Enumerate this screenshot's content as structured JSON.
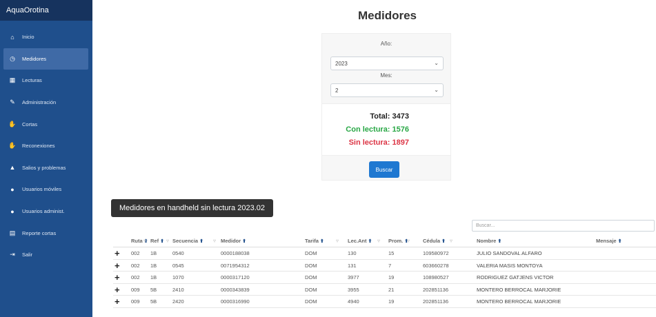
{
  "brand": "AquaOrotina",
  "sidebar": {
    "items": [
      {
        "label": "Inicio",
        "icon": "home-icon",
        "glyph": "⌂"
      },
      {
        "label": "Medidores",
        "icon": "clock-icon",
        "glyph": "◷",
        "active": true
      },
      {
        "label": "Lecturas",
        "icon": "calculator-icon",
        "glyph": "▦"
      },
      {
        "label": "Administración",
        "icon": "pencil-icon",
        "glyph": "✎"
      },
      {
        "label": "Cortas",
        "icon": "thumbs-down-icon",
        "glyph": "✋"
      },
      {
        "label": "Reconexiones",
        "icon": "thumbs-up-icon",
        "glyph": "✋"
      },
      {
        "label": "Salios y problemas",
        "icon": "warning-icon",
        "glyph": "▲"
      },
      {
        "label": "Usuarios móviles",
        "icon": "user-icon",
        "glyph": "●"
      },
      {
        "label": "Usuarios administ.",
        "icon": "users-icon",
        "glyph": "●"
      },
      {
        "label": "Reporte cortas",
        "icon": "report-icon",
        "glyph": "▤"
      },
      {
        "label": "Salir",
        "icon": "logout-icon",
        "glyph": "⇥"
      }
    ]
  },
  "main": {
    "title": "Medidores",
    "filter": {
      "year_label": "Año:",
      "year_value": "2023",
      "month_label": "Mes:",
      "month_value": "2",
      "total": "Total: 3473",
      "con_lectura": "Con lectura: 1576",
      "sin_lectura": "Sin lectura: 1897",
      "button": "Buscar"
    },
    "section_title": "Medidores en handheld sin lectura 2023.02",
    "search_placeholder": "Buscar...",
    "table": {
      "columns": [
        "Ruta",
        "Ref",
        "Secuencia",
        "Medidor",
        "Tarifa",
        "Lec.Ant",
        "Prom.",
        "Cédula",
        "Nombre",
        "Mensaje"
      ],
      "rows": [
        [
          "002",
          "1B",
          "0540",
          "0000188038",
          "DOM",
          "130",
          "15",
          "109580972",
          "JULIO SANDOVAL ALFARO",
          ""
        ],
        [
          "002",
          "1B",
          "0545",
          "0071954312",
          "DOM",
          "131",
          "7",
          "603660278",
          "VALERIA MASIS MONTOYA",
          ""
        ],
        [
          "002",
          "1B",
          "1070",
          "0000317120",
          "DOM",
          "3977",
          "19",
          "108980527",
          "RODRIGUEZ GATJENS VICTOR",
          ""
        ],
        [
          "009",
          "5B",
          "2410",
          "0000343839",
          "DOM",
          "3955",
          "21",
          "202851136",
          "MONTERO BERROCAL MARJORIE",
          ""
        ],
        [
          "009",
          "5B",
          "2420",
          "0000316990",
          "DOM",
          "4940",
          "19",
          "202851136",
          "MONTERO BERROCAL MARJORIE",
          ""
        ]
      ]
    }
  },
  "colors": {
    "sidebar": "#1f4f8c",
    "brand_bar": "#16335e",
    "primary": "#1f78d1",
    "success": "#28a745",
    "danger": "#dc3545"
  }
}
